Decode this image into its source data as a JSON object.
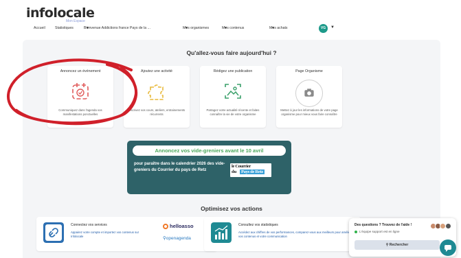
{
  "header": {
    "logo": "infolocale",
    "logo_sub": "Mon Espace",
    "nav": [
      {
        "label": "Accueil"
      },
      {
        "label": "Statistiques"
      },
      {
        "label": "Bienvenue Addictions france Pays de la ..."
      },
      {
        "label": "Mes organismes"
      },
      {
        "label": "Mes contenus"
      },
      {
        "label": "Mes achats"
      }
    ],
    "avatar_initials": "VG"
  },
  "main": {
    "question": "Qu'allez-vous faire aujourd'hui ?",
    "cards": [
      {
        "title": "Annoncez un événement",
        "desc": "Communiquez dans l'agenda vos manifestations ponctuelles",
        "icon": "calendar-icon"
      },
      {
        "title": "Ajoutez une activité",
        "desc": "Inscrivez vos cours, ateliers, entrainements récurrents",
        "icon": "puzzle-icon"
      },
      {
        "title": "Rédigez une publication",
        "desc": "Partagez votre actualité récente et faites connaître la vie de votre organisme",
        "icon": "image-icon"
      },
      {
        "title": "Page Organisme",
        "desc": "Mettez à jour les informations de votre page organisme pour mieux vous faire connaître",
        "icon": "camera-icon"
      }
    ],
    "banner": {
      "headline": "Annoncez vos vide-greniers avant le 10 avril",
      "body": "pour paraître dans le calendrier 2026 des vide-greniers du Courrier du pays de Retz",
      "brand_line1": "le Courrier",
      "brand_line2a": "du",
      "brand_line2b": "Pays de Retz"
    },
    "optimize_title": "Optimisez vos actions",
    "actions": [
      {
        "title": "Connectez vos services",
        "desc": "Appairez votre compte et importez vos contenus sur Infolocale",
        "partner1": "helloasso",
        "partner2": "openagenda",
        "icon": "link-icon"
      },
      {
        "title": "Consultez vos statistiques",
        "desc": "Accédez aux chiffres de vos performances, comparez-vous aux meilleurs pour améliorer vos contenus et votre communication",
        "icon": "stats-icon"
      }
    ]
  },
  "help": {
    "title": "Des questions ? Trouvez de l'aide !",
    "status": "L'équipe support est en ligne",
    "search_label": "Rechercher"
  },
  "colors": {
    "accent": "#2e6268",
    "annotation": "#d0202a",
    "icon": "#e05a5a",
    "icon_yellow": "#e8b93a",
    "icon_green": "#3aa06a"
  }
}
